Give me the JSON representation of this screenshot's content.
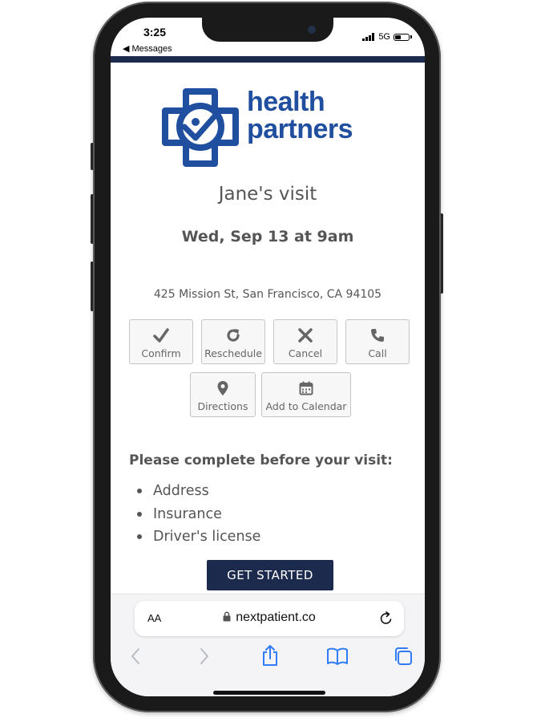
{
  "status_bar": {
    "time": "3:25",
    "back_app": "◀ Messages",
    "network": "5G"
  },
  "brand": {
    "line1": "health",
    "line2": "partners",
    "color": "#1f4f9e"
  },
  "visit": {
    "title": "Jane's visit",
    "datetime": "Wed, Sep 13 at 9am",
    "address": "425 Mission St, San Francisco, CA 94105"
  },
  "actions": [
    {
      "label": "Confirm",
      "icon": "check-icon"
    },
    {
      "label": "Reschedule",
      "icon": "refresh-icon"
    },
    {
      "label": "Cancel",
      "icon": "close-icon"
    },
    {
      "label": "Call",
      "icon": "phone-icon"
    },
    {
      "label": "Directions",
      "icon": "map-pin-icon"
    },
    {
      "label": "Add to Calendar",
      "icon": "calendar-icon"
    }
  ],
  "requirements": {
    "title": "Please complete before your visit:",
    "items": [
      "Address",
      "Insurance",
      "Driver's license"
    ]
  },
  "cta": {
    "label": "GET STARTED",
    "color": "#1c2a4d"
  },
  "browser": {
    "text_size_label": "AA",
    "url": "nextpatient.co"
  }
}
